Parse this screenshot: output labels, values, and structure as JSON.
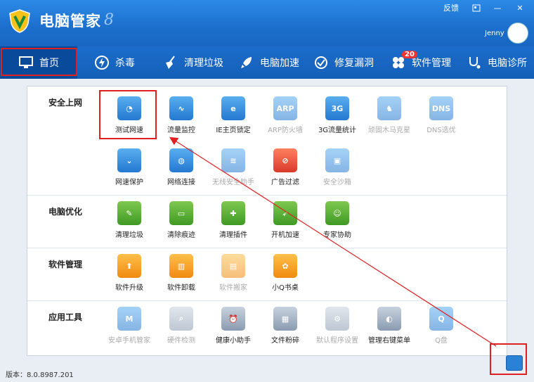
{
  "app": {
    "title": "电脑管家",
    "mark": "8"
  },
  "window": {
    "feedback": "反馈",
    "skin_icon": "skin-icon",
    "min": "—",
    "close": "✕"
  },
  "user": {
    "name": "Jenny"
  },
  "nav": [
    {
      "label": "首页",
      "icon": "monitor-icon"
    },
    {
      "label": "杀毒",
      "icon": "shield-icon"
    },
    {
      "label": "清理垃圾",
      "icon": "broom-icon"
    },
    {
      "label": "电脑加速",
      "icon": "rocket-icon"
    },
    {
      "label": "修复漏洞",
      "icon": "patch-icon"
    },
    {
      "label": "软件管理",
      "icon": "apps-icon",
      "badge": "20"
    },
    {
      "label": "电脑诊所",
      "icon": "stethoscope-icon"
    }
  ],
  "sections": [
    {
      "title": "安全上网",
      "tiles": [
        {
          "label": "测试网速"
        },
        {
          "label": "流量监控"
        },
        {
          "label": "IE主页锁定"
        },
        {
          "label": "ARP防火墙",
          "icon_text": "ARP"
        },
        {
          "label": "3G流量统计",
          "icon_text": "3G"
        },
        {
          "label": "顽固木马克星"
        },
        {
          "label": "DNS选优",
          "icon_text": "DNS"
        },
        {
          "label": "网速保护"
        },
        {
          "label": "网络连接"
        },
        {
          "label": "无线安全助手"
        },
        {
          "label": "广告过滤"
        },
        {
          "label": "安全沙箱"
        }
      ]
    },
    {
      "title": "电脑优化",
      "tiles": [
        {
          "label": "清理垃圾"
        },
        {
          "label": "清除痕迹"
        },
        {
          "label": "清理插件"
        },
        {
          "label": "开机加速"
        },
        {
          "label": "专家协助"
        }
      ]
    },
    {
      "title": "软件管理",
      "tiles": [
        {
          "label": "软件升级"
        },
        {
          "label": "软件卸载"
        },
        {
          "label": "软件搬家"
        },
        {
          "label": "小Q书桌"
        }
      ]
    },
    {
      "title": "应用工具",
      "tiles": [
        {
          "label": "安卓手机管家",
          "icon_text": "M"
        },
        {
          "label": "硬件检测"
        },
        {
          "label": "健康小助手"
        },
        {
          "label": "文件粉碎"
        },
        {
          "label": "默认程序设置"
        },
        {
          "label": "管理右键菜单"
        },
        {
          "label": "Q盘",
          "icon_text": "Q"
        }
      ]
    }
  ],
  "footer": {
    "version": "版本：8.0.8987.201"
  }
}
